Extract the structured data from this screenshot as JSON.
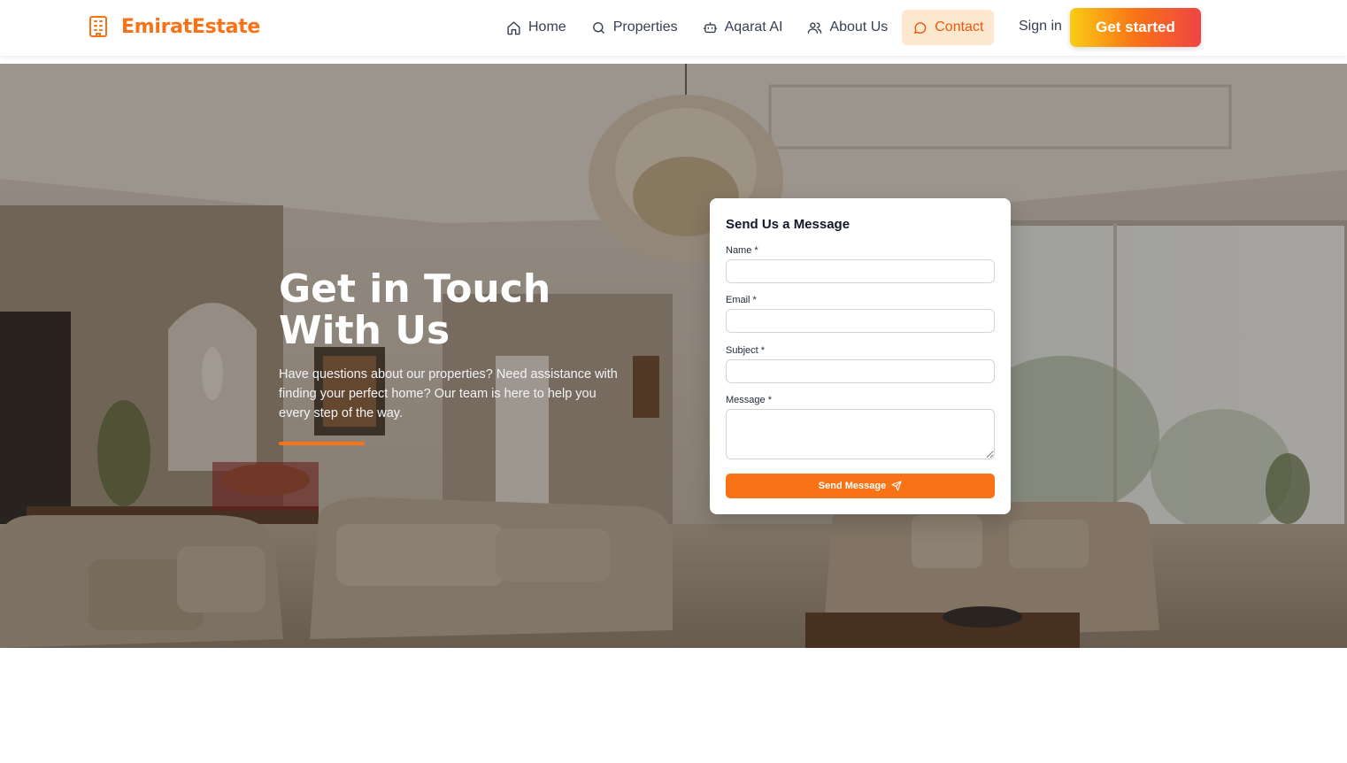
{
  "brand": {
    "name": "EmiratEstate",
    "icon": "building-icon",
    "accent": "#f97316"
  },
  "nav": {
    "items": [
      {
        "label": "Home",
        "icon": "home-icon"
      },
      {
        "label": "Properties",
        "icon": "search-icon"
      },
      {
        "label": "Aqarat AI",
        "icon": "bot-icon"
      },
      {
        "label": "About Us",
        "icon": "users-icon"
      },
      {
        "label": "Contact",
        "icon": "chat-icon",
        "active": true
      }
    ],
    "signin": "Sign in",
    "cta": "Get started"
  },
  "hero": {
    "title_line1": "Get in Touch",
    "title_line2": "With Us",
    "text": "Have questions about our properties? Need assistance with finding your perfect home? Our team is here to help you every step of the way."
  },
  "form": {
    "title": "Send Us a Message",
    "fields": [
      {
        "label": "Name *",
        "value": ""
      },
      {
        "label": "Email *",
        "value": ""
      },
      {
        "label": "Subject *",
        "value": ""
      },
      {
        "label": "Message *",
        "value": ""
      }
    ],
    "submit": "Send Message",
    "submit_icon": "send-icon"
  },
  "colors": {
    "primary": "#f97316",
    "active_bg": "#fde7cf",
    "text": "#374151"
  }
}
